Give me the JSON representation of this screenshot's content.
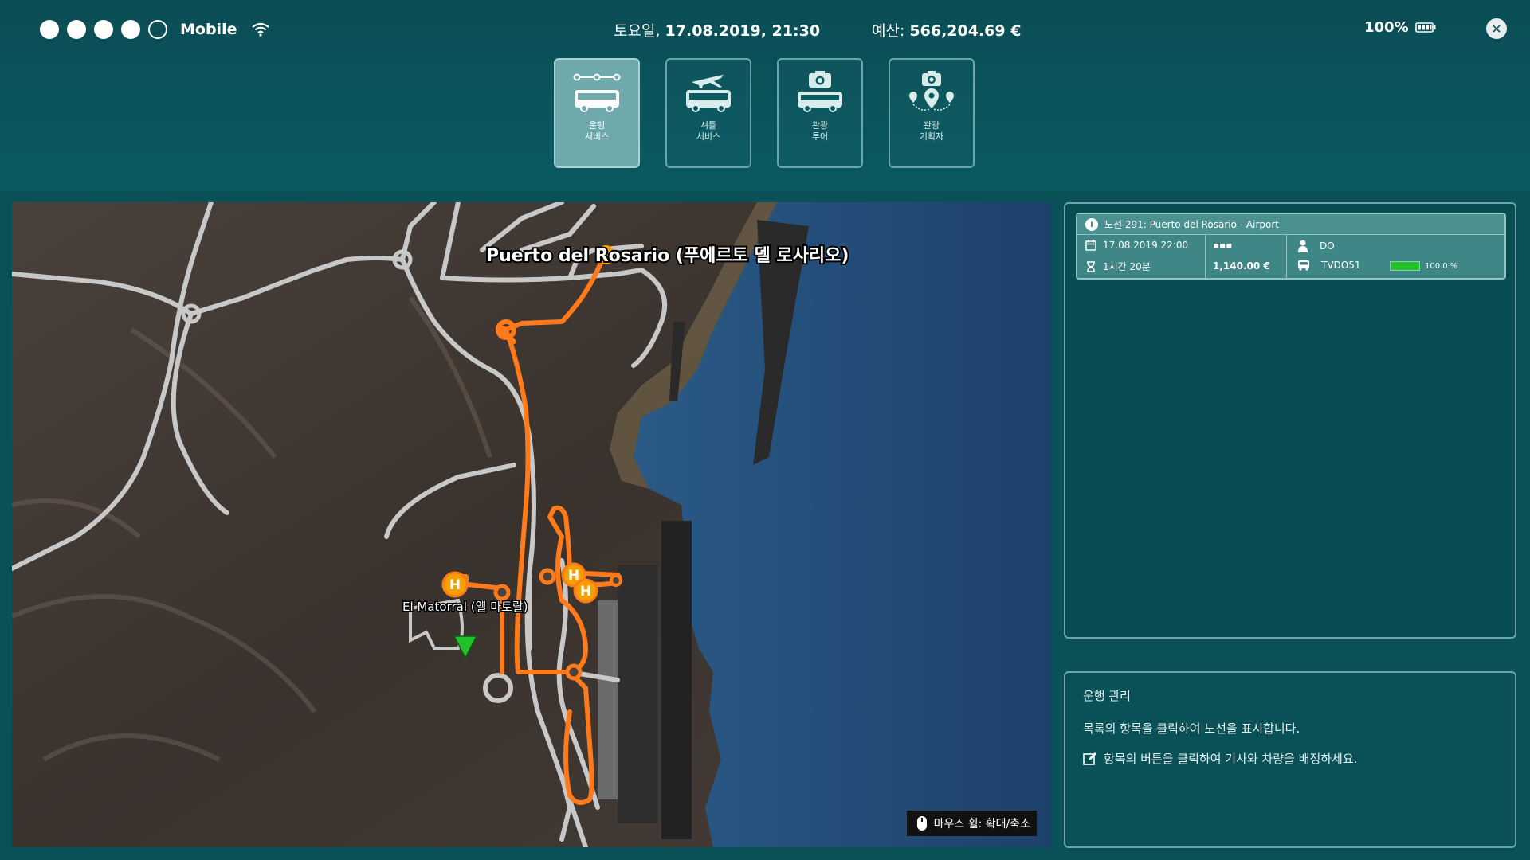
{
  "status": {
    "signal_dots_filled": 4,
    "signal_dots_total": 5,
    "carrier": "Mobile"
  },
  "datetime": {
    "day": "토요일, ",
    "value": "17.08.2019, 21:30"
  },
  "budget": {
    "label": "예산: ",
    "value": "566,204.69 €"
  },
  "battery": {
    "percent": "100%"
  },
  "modes": [
    {
      "label": "운행\n서비스",
      "icon": "bus-route-icon",
      "active": true
    },
    {
      "label": "셔틀\n서비스",
      "icon": "shuttle-plane-icon",
      "active": false
    },
    {
      "label": "관광\n투어",
      "icon": "tour-camera-bus-icon",
      "active": false
    },
    {
      "label": "관광\n기획자",
      "icon": "tour-planner-camera-pin-icon",
      "active": false
    }
  ],
  "map": {
    "city_label": "Puerto del Rosario (푸에르토 델 로사리오)",
    "stop_label": "El Matorral (엘 마토랄)",
    "stop_markers": [
      "H",
      "H",
      "H"
    ],
    "zoom_hint": "마우스 휠: 확대/축소",
    "route_color": "#ff7a1a"
  },
  "route": {
    "title": "노선 291: Puerto del Rosario - Airport",
    "date": "17.08.2019  22:00",
    "duration": "1시간 20분",
    "rating": "▪▪▪",
    "price": "1,140.00 €",
    "driver": "DO",
    "vehicle": "TVDO51",
    "condition_label": "100.0 %",
    "condition_fraction": 1.0
  },
  "management": {
    "title": "운행 관리",
    "line1": "목록의 항목을 클릭하여 노선을 표시합니다.",
    "line2": "항목의 버튼을 클릭하여 기사와 차량을 배정하세요."
  }
}
